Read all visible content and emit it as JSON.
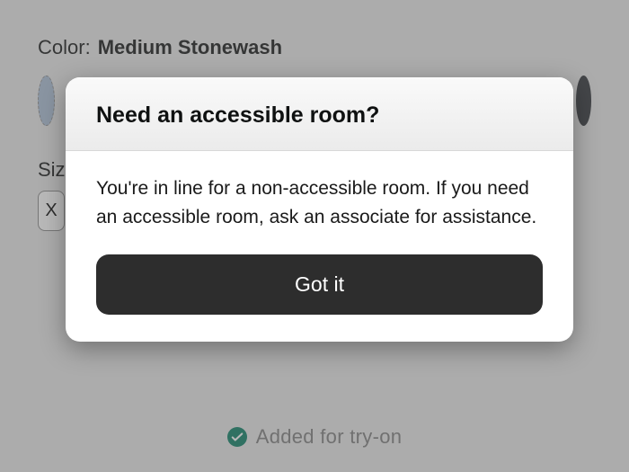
{
  "product": {
    "color_label": "Color:",
    "color_value": "Medium Stonewash",
    "size_label": "Size",
    "size_option": "X",
    "added_text": "Added for try-on"
  },
  "modal": {
    "title": "Need an accessible room?",
    "body": "You're in line for a non-accessible room. If you need an accessible room, ask an associate for assistance.",
    "button_label": "Got it"
  }
}
